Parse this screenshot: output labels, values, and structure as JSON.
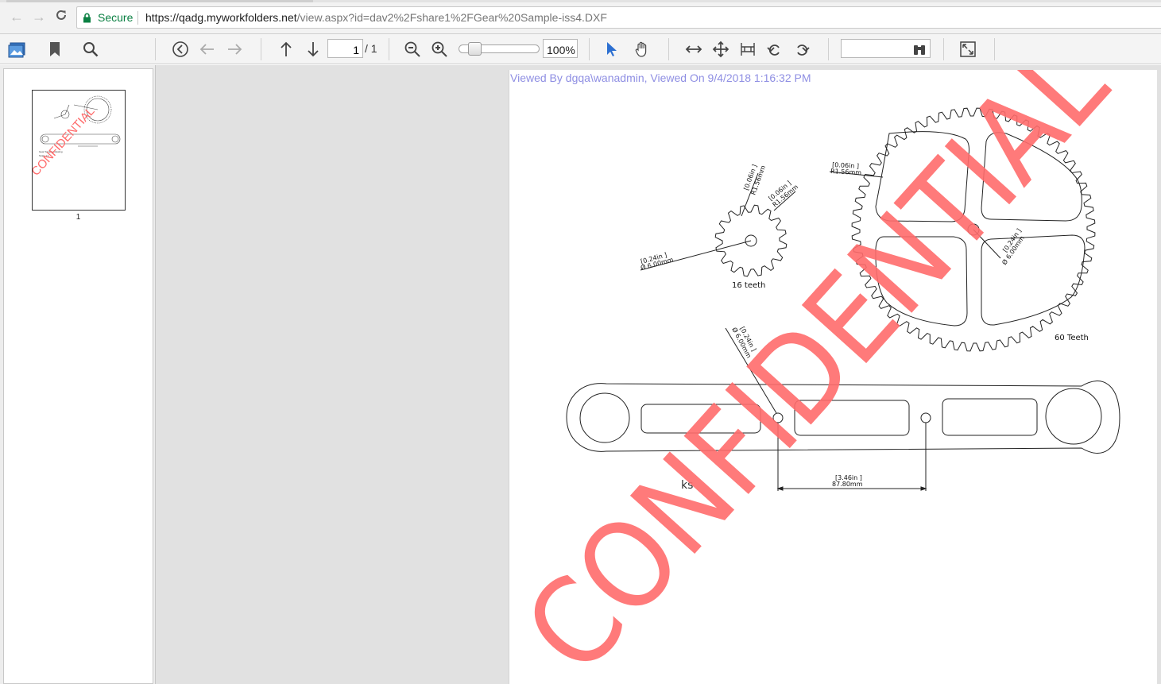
{
  "browser": {
    "secure_label": "Secure",
    "url_host": "https://qadg.myworkfolders.net",
    "url_path": "/view.aspx?id=dav2%2Fshare1%2FGear%20Sample-iss4.DXF"
  },
  "toolbar": {
    "page_current": "1",
    "page_total": "/ 1",
    "zoom_value": "100%",
    "zoom_fraction": 0.2
  },
  "thumbnails": {
    "items": [
      {
        "label": "1"
      }
    ]
  },
  "document": {
    "viewed_by": "Viewed By dgqa\\wanadmin, Viewed On 9/4/2018 1:16:32 PM",
    "watermark": "CONFIDENTIAL",
    "watermark_color": "#ff6b6b",
    "small_gear": {
      "caption": "16 teeth",
      "dim_hole_in": "[0.24in ]",
      "dim_hole_mm": "Ø 6.00mm",
      "dim_top_in": "[0.06in ]",
      "dim_top_mm": "R1.56mm",
      "dim_root_in": "[0.06in ]",
      "dim_root_mm": "R1.56mm"
    },
    "big_gear": {
      "caption": "60 Teeth",
      "dim_tooth_in": "[0.06in ]",
      "dim_tooth_mm": "R1.56mm",
      "dim_hole_in": "[0.24in ]",
      "dim_hole_mm": "Ø 6.00mm"
    },
    "link_arm": {
      "dim_hole_in": "[0.24in ]",
      "dim_hole_mm": "Ø 6.00mm",
      "dim_span_in": "[3.46in ]",
      "dim_span_mm": "87.80mm",
      "fragment_text": "ks"
    }
  }
}
